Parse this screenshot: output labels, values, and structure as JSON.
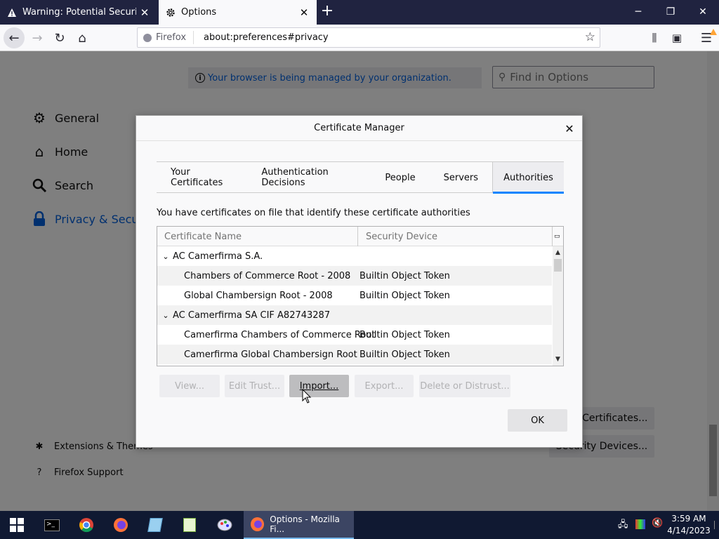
{
  "browser": {
    "tabs": [
      {
        "title": "Warning: Potential Security Risk Ahead",
        "active": false
      },
      {
        "title": "Options",
        "active": true
      }
    ],
    "identity_label": "Firefox",
    "url": "about:preferences#privacy"
  },
  "prefs": {
    "managed_banner": "Your browser is being managed by your organization.",
    "find_placeholder": "Find in Options",
    "categories": [
      {
        "label": "General",
        "icon": "gear-icon"
      },
      {
        "label": "Home",
        "icon": "home-icon"
      },
      {
        "label": "Search",
        "icon": "search-icon"
      },
      {
        "label": "Privacy & Security",
        "icon": "lock-icon",
        "selected": true
      }
    ],
    "footer_links": [
      {
        "label": "Extensions & Themes",
        "icon": "puzzle-icon"
      },
      {
        "label": "Firefox Support",
        "icon": "help-icon"
      }
    ],
    "view_certificates_label": "View Certificates...",
    "security_devices_label": "Security Devices..."
  },
  "dialog": {
    "title": "Certificate Manager",
    "tabs": [
      "Your Certificates",
      "Authentication Decisions",
      "People",
      "Servers",
      "Authorities"
    ],
    "selected_tab": "Authorities",
    "description": "You have certificates on file that identify these certificate authorities",
    "columns": [
      "Certificate Name",
      "Security Device"
    ],
    "rows": [
      {
        "name": "AC Camerfirma S.A.",
        "device": "",
        "group": true
      },
      {
        "name": "Chambers of Commerce Root - 2008",
        "device": "Builtin Object Token",
        "group": false
      },
      {
        "name": "Global Chambersign Root - 2008",
        "device": "Builtin Object Token",
        "group": false
      },
      {
        "name": "AC Camerfirma SA CIF A82743287",
        "device": "",
        "group": true
      },
      {
        "name": "Camerfirma Chambers of Commerce Root",
        "device": "Builtin Object Token",
        "group": false
      },
      {
        "name": "Camerfirma Global Chambersign Root",
        "device": "Builtin Object Token",
        "group": false
      }
    ],
    "buttons": {
      "view": "View...",
      "edit_trust": "Edit Trust...",
      "import": "Import...",
      "export": "Export...",
      "delete": "Delete or Distrust..."
    },
    "ok": "OK"
  },
  "taskbar": {
    "active_window": "Options - Mozilla Fi...",
    "time": "3:59 AM",
    "date": "4/14/2023"
  }
}
